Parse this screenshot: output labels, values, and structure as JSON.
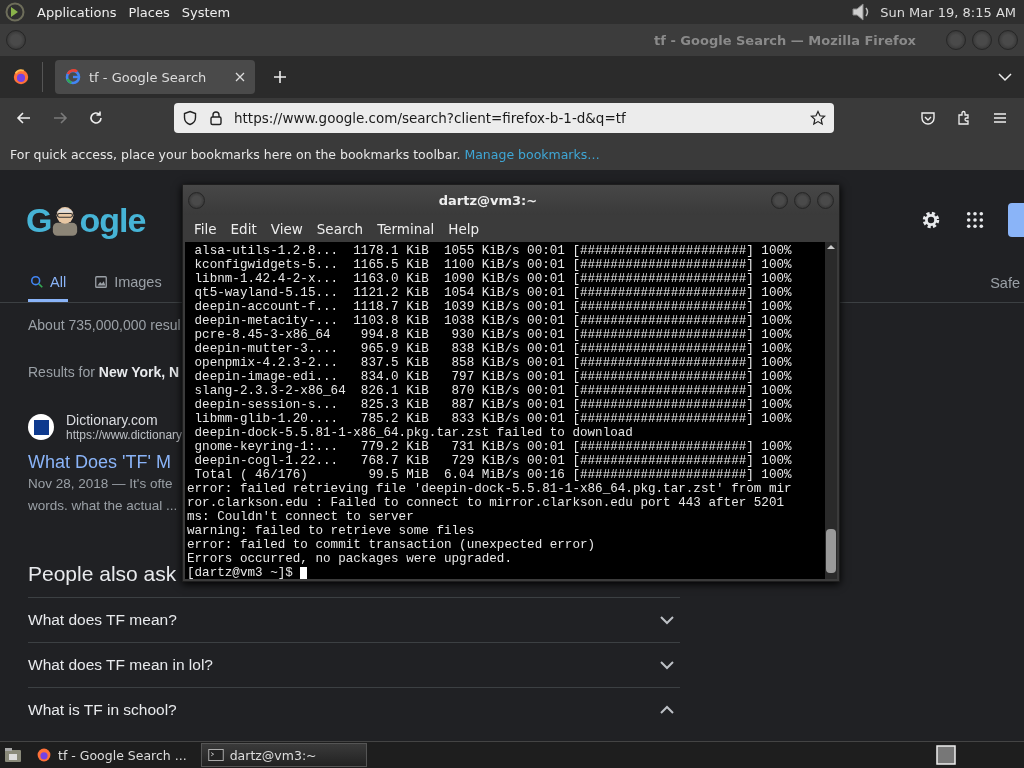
{
  "top_panel": {
    "menus": [
      "Applications",
      "Places",
      "System"
    ],
    "clock": "Sun Mar 19,  8:15 AM"
  },
  "browser": {
    "title": "tf - Google Search — Mozilla Firefox",
    "tabs": [
      {
        "label": "tf - Google Search",
        "selected": true
      }
    ],
    "forward_disabled": true,
    "url": "https://www.google.com/search?client=firefox-b-1-d&q=tf",
    "bookmarks_hint": "For quick access, place your bookmarks here on the bookmarks toolbar.",
    "bookmarks_link": "Manage bookmarks…"
  },
  "google": {
    "logo": [
      "G",
      "ogle"
    ],
    "tabs": [
      {
        "label": "All",
        "kind": "search",
        "selected": true
      },
      {
        "label": "Images",
        "kind": "image",
        "selected": false
      }
    ],
    "safesearch": "Safe",
    "result_stats": "About 735,000,000 resul",
    "location": "Results for **New York, N**",
    "result": {
      "site": "Dictionary.com",
      "url": "https://www.dictionary",
      "title": "What Does 'TF' M",
      "snippet": [
        "Nov 28, 2018 — It's ofte",
        "words. what the actual ..."
      ]
    },
    "people_also_ask": {
      "heading": "People also ask",
      "questions": [
        {
          "text": "What does TF mean?",
          "expanded": false
        },
        {
          "text": "What does TF mean in lol?",
          "expanded": false
        },
        {
          "text": "What is TF in school?",
          "expanded": true
        }
      ]
    }
  },
  "terminal": {
    "title": "dartz@vm3:~",
    "menus": [
      "File",
      "Edit",
      "View",
      "Search",
      "Terminal",
      "Help"
    ],
    "lines": [
      " alsa-utils-1.2.8...  1178.1 KiB  1055 KiB/s 00:01 [######################] 100%",
      " kconfigwidgets-5...  1165.5 KiB  1100 KiB/s 00:01 [######################] 100%",
      " libnm-1.42.4-2-x...  1163.0 KiB  1090 KiB/s 00:01 [######################] 100%",
      " qt5-wayland-5.15...  1121.2 KiB  1054 KiB/s 00:01 [######################] 100%",
      " deepin-account-f...  1118.7 KiB  1039 KiB/s 00:01 [######################] 100%",
      " deepin-metacity-...  1103.8 KiB  1038 KiB/s 00:01 [######################] 100%",
      " pcre-8.45-3-x86_64    994.8 KiB   930 KiB/s 00:01 [######################] 100%",
      " deepin-mutter-3....   965.9 KiB   838 KiB/s 00:01 [######################] 100%",
      " openpmix-4.2.3-2...   837.5 KiB   858 KiB/s 00:01 [######################] 100%",
      " deepin-image-edi...   834.0 KiB   797 KiB/s 00:01 [######################] 100%",
      " slang-2.3.3-2-x86_64  826.1 KiB   870 KiB/s 00:01 [######################] 100%",
      " deepin-session-s...   825.3 KiB   887 KiB/s 00:01 [######################] 100%",
      " libmm-glib-1.20....   785.2 KiB   833 KiB/s 00:01 [######################] 100%",
      " deepin-dock-5.5.81-1-x86_64.pkg.tar.zst failed to download",
      " gnome-keyring-1:...   779.2 KiB   731 KiB/s 00:01 [######################] 100%",
      " deepin-cogl-1.22...   768.7 KiB   729 KiB/s 00:01 [######################] 100%",
      " Total ( 46/176)        99.5 MiB  6.04 MiB/s 00:16 [######################] 100%",
      "error: failed retrieving file 'deepin-dock-5.5.81-1-x86_64.pkg.tar.zst' from mir",
      "ror.clarkson.edu : Failed to connect to mirror.clarkson.edu port 443 after 5201",
      "ms: Couldn't connect to server",
      "warning: failed to retrieve some files",
      "error: failed to commit transaction (unexpected error)",
      "Errors occurred, no packages were upgraded."
    ],
    "prompt": "[dartz@vm3 ~]$ "
  },
  "taskbar": {
    "tasks": [
      {
        "label": "tf - Google Search ...",
        "kind": "browser",
        "selected": false
      },
      {
        "label": "dartz@vm3:~",
        "kind": "terminal",
        "selected": true
      }
    ]
  }
}
